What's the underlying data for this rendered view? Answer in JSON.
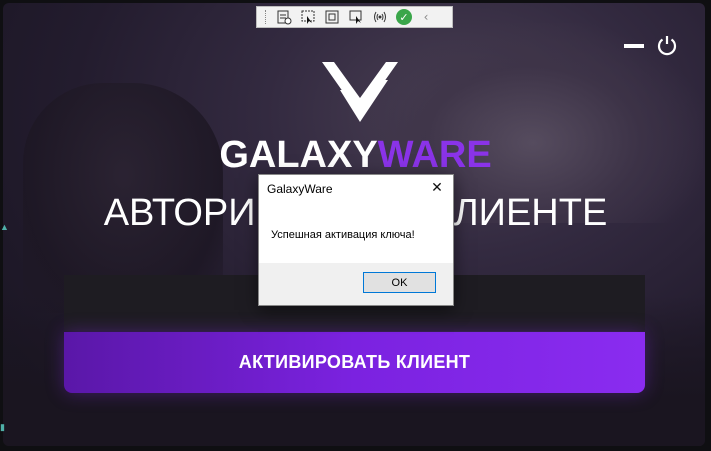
{
  "toolbar": {
    "icons": [
      "grip-icon",
      "rect-select-icon",
      "pointer-select-icon",
      "window-capture-icon",
      "fullscreen-icon",
      "pointer-window-icon",
      "wireless-icon",
      "check-icon",
      "chevron-left-icon"
    ],
    "check_color": "#3aa64a"
  },
  "window_controls": {
    "minimize": "minimize-icon",
    "power": "power-icon"
  },
  "brand": {
    "part1": "GALAXY",
    "part2": "WARE",
    "part1_color": "#ffffff",
    "part2_color": "#8a33e8"
  },
  "heading": {
    "left": "АВТОРИ",
    "right": "КЛИЕНТЕ"
  },
  "activate_button": {
    "label": "АКТИВИРОВАТЬ КЛИЕНТ",
    "gradient": [
      "#5a17a8",
      "#8a2cf0"
    ]
  },
  "dialog": {
    "title": "GalaxyWare",
    "message": "Успешная активация ключа!",
    "ok_label": "OK"
  }
}
